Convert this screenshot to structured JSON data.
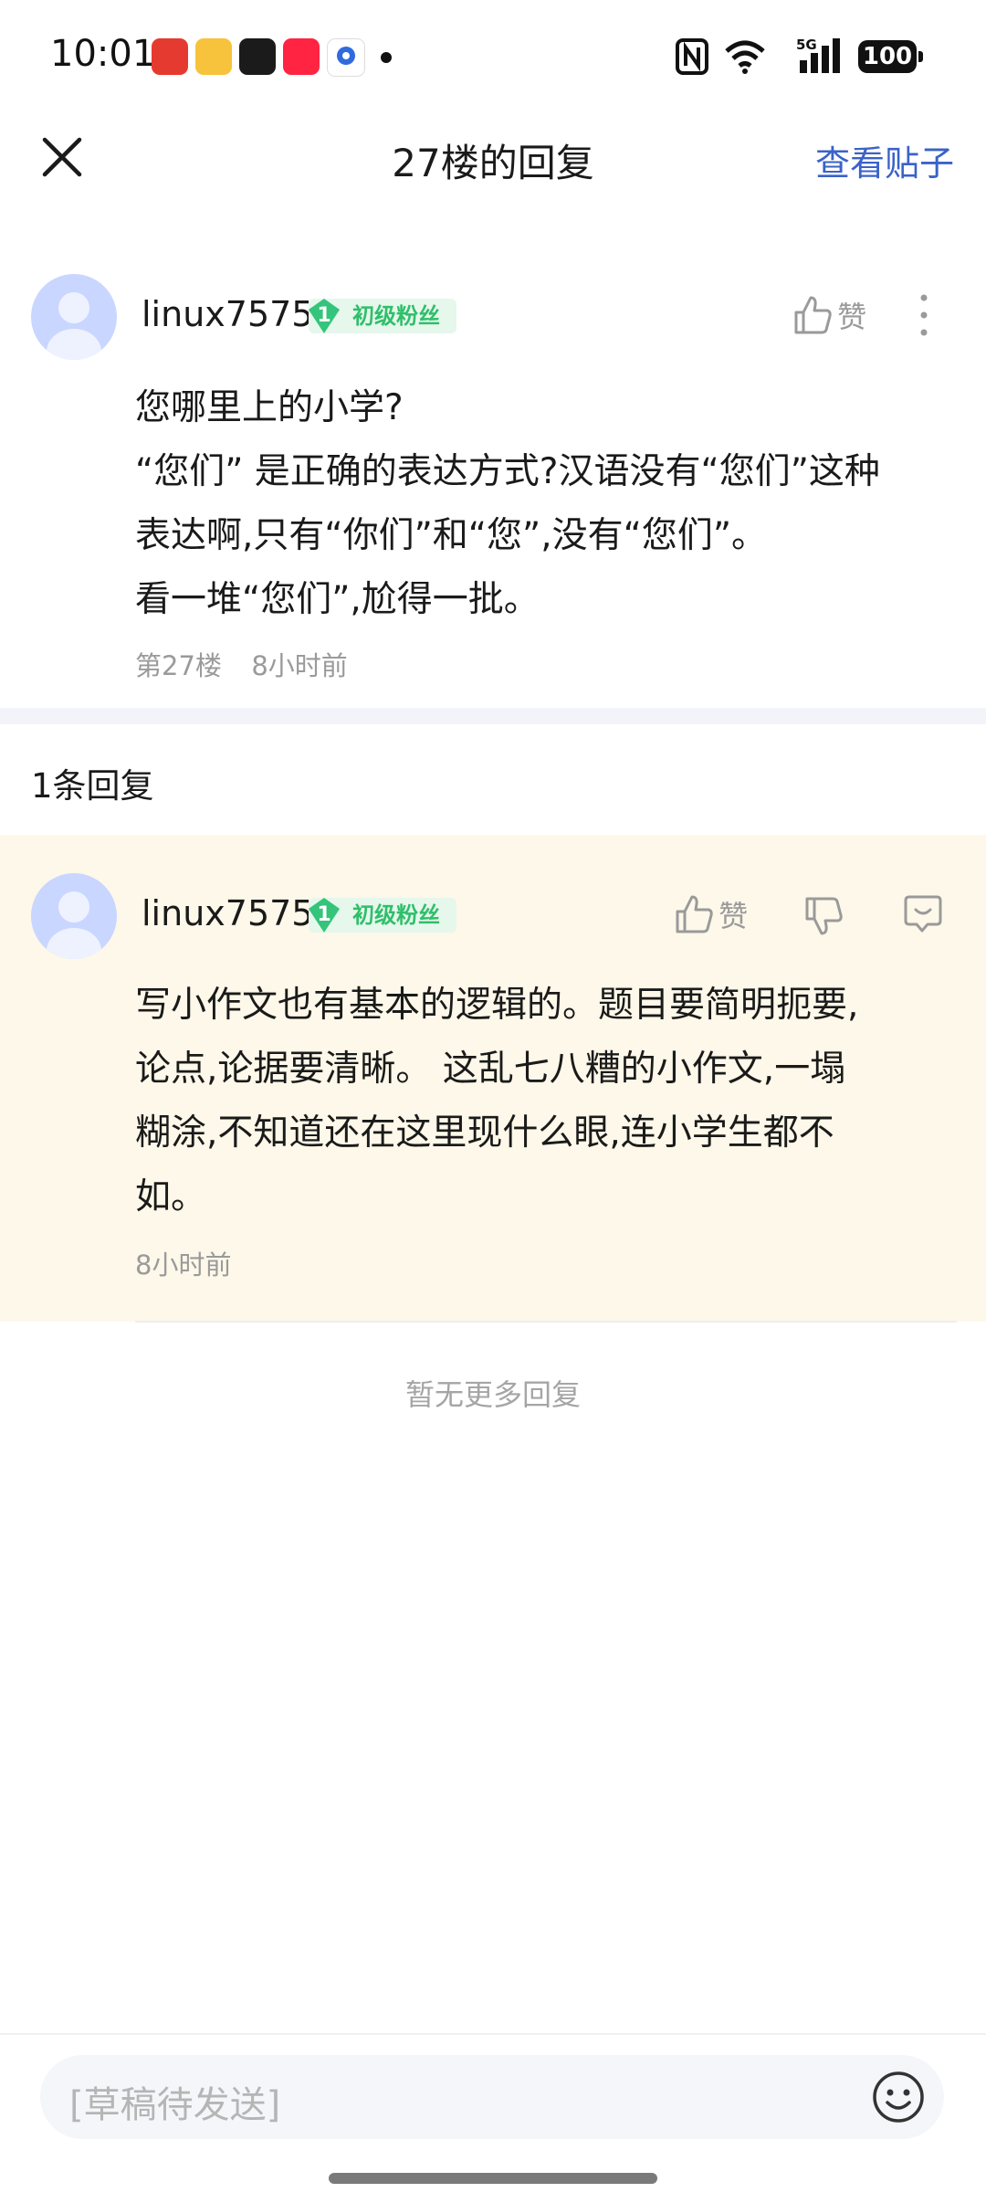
{
  "status_bar": {
    "time": "10:01",
    "battery": "100"
  },
  "header": {
    "title": "27楼的回复",
    "view_post": "查看贴子"
  },
  "main_post": {
    "username": "linux7575",
    "badge_level": "1",
    "badge_label": "初级粉丝",
    "like_label": "赞",
    "lines": [
      "您哪里上的小学?",
      "“您们” 是正确的表达方式?汉语没有“您们”这种",
      "表达啊,只有“你们”和“您”,没有“您们”。",
      "看一堆“您们”,尬得一批。"
    ],
    "floor": "第27楼",
    "time": "8小时前"
  },
  "reply_count": "1条回复",
  "reply": {
    "username": "linux7575",
    "badge_level": "1",
    "badge_label": "初级粉丝",
    "like_label": "赞",
    "lines": [
      "写小作文也有基本的逻辑的。题目要简明扼要,",
      "论点,论据要清晰。 这乱七八糟的小作文,一塌",
      "糊涂,不知道还在这里现什么眼,连小学生都不",
      "如。"
    ],
    "time": "8小时前"
  },
  "no_more": "暂无更多回复",
  "input": {
    "placeholder": "[草稿待发送]"
  }
}
